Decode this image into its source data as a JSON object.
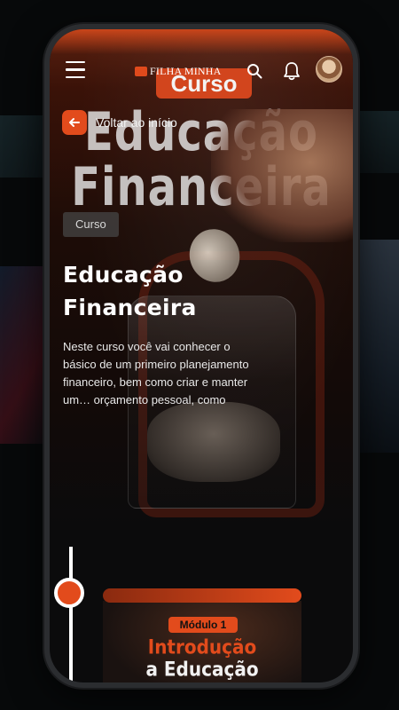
{
  "app": {
    "brand": "FILHA MINHA"
  },
  "hero": {
    "pill": "Curso",
    "title_line_1": "Educação",
    "title_line_2": "Financeira"
  },
  "topbar": {
    "menu_icon": "hamburger-icon",
    "search_icon": "search-icon",
    "bell_icon": "bell-icon"
  },
  "nav": {
    "back_label": "Voltar ao início"
  },
  "course": {
    "tag": "Curso",
    "title": "Educação Financeira",
    "description": "Neste curso você vai conhecer o básico de um primeiro planejamento financeiro, bem como criar e manter um… orçamento pessoal, como"
  },
  "modules": [
    {
      "badge": "Módulo 1",
      "title_line_1": "Introdução",
      "title_line_2": "a Educação Financeira"
    }
  ],
  "colors": {
    "accent": "#e24b1c",
    "background": "#0b0b0c"
  }
}
